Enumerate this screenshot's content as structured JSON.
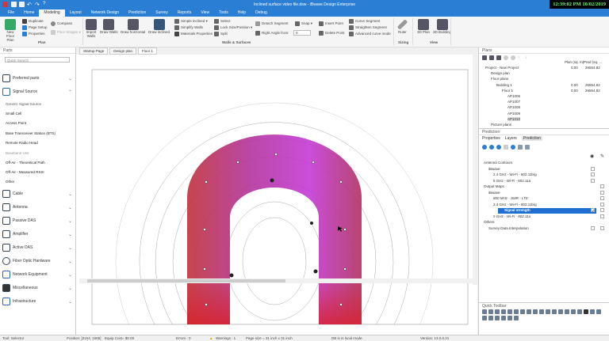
{
  "window": {
    "title": "Inclined surface video file.dsw - iBwave Design Enterprise",
    "clock": "12:39:02 PM 10/02/2019"
  },
  "tabs": [
    "File",
    "Home",
    "Modeling",
    "Layout",
    "Network Design",
    "Prediction",
    "Survey",
    "Reports",
    "View",
    "Tools",
    "Help",
    "Debug"
  ],
  "ribbon": {
    "plan": {
      "new_floor_plan": "New Floor Plan",
      "duplicate": "Duplicate",
      "page_setup": "Page Setup",
      "properties": "Properties",
      "compass": "Compass",
      "floor_images": "Floor Images",
      "group": "Plan"
    },
    "walls": {
      "import_walls": "Import Walls",
      "draw_walls": "Draw Walls",
      "draw_horizontal": "Draw horizontal",
      "draw_inclined": "Draw inclined",
      "simple_inclined": "Simple inclined",
      "simplify_walls": "Simplify Walls",
      "materials_properties": "Materials Properties",
      "select": "Select",
      "lock_size_position": "Lock Size/Position",
      "split": "Split",
      "detach_segment": "Detach Segment",
      "snap": "Snap",
      "right_angle_from": "Right Angle from:",
      "right_angle_value": "0",
      "insert_point": "Insert Point",
      "delete_point": "Delete Point",
      "curve_segment": "Curve Segment",
      "straighten_segment": "Straighten Segment",
      "advanced_curve_mode": "Advanced curve mode",
      "group": "Walls & Surfaces"
    },
    "sizing": {
      "ruler": "Ruler",
      "group": "Sizing"
    },
    "view": {
      "plan3d": "3D Plan",
      "building3d": "3D Building",
      "group": "View"
    }
  },
  "parts": {
    "title": "Parts",
    "search_placeholder": "Quick Search",
    "categories": [
      "Preferred parts",
      "Signal Source",
      "Cable",
      "Antenna",
      "Passive DAS",
      "Amplifier",
      "Active DAS",
      "Fiber Optic Hardware",
      "Network Equipment",
      "Miscellaneous",
      "Infrastructure"
    ],
    "signal_source_items": [
      "Generic Signal Source",
      "Small Cell",
      "Access Point",
      "Base Transceiver Station (BTS)",
      "Remote Radio Head",
      "Baseband Unit",
      "Off-Air - Theoretical Path",
      "Off-Air - Measured RSSI",
      "Other"
    ]
  },
  "doc_tabs": [
    "Startup Page",
    "Design plan",
    "Floor 1"
  ],
  "plans": {
    "title": "Plans",
    "columns": [
      "Plan (sq. m)",
      "Pred (sq. ..."
    ],
    "tree": [
      {
        "label": "Project - New Project",
        "plan": "0.00",
        "pred": "26554.82"
      },
      {
        "label": "Design plan",
        "plan": "",
        "pred": ""
      },
      {
        "label": "Floor plans",
        "plan": "",
        "pred": ""
      },
      {
        "label": "Building 1",
        "plan": "0.00",
        "pred": "26554.82"
      },
      {
        "label": "Floor 1",
        "plan": "0.00",
        "pred": "26554.82"
      },
      {
        "label": "AP1006",
        "plan": "",
        "pred": ""
      },
      {
        "label": "AP1007",
        "plan": "",
        "pred": ""
      },
      {
        "label": "AP1008",
        "plan": "",
        "pred": ""
      },
      {
        "label": "AP1009",
        "plan": "",
        "pred": ""
      },
      {
        "label": "AP1010",
        "plan": "",
        "pred": ""
      },
      {
        "label": "Picture plans",
        "plan": "",
        "pred": ""
      }
    ]
  },
  "prediction": {
    "title": "Prediction",
    "tabs": [
      "Properties",
      "Layers",
      "Prediction"
    ],
    "tree": [
      "Antenna Contours",
      "iBwave",
      "2.4 GHz - Wi-Fi - 802.11b/g",
      "5 GHz - Wi-Fi - 802.11a",
      "Output Maps",
      "iBwave",
      "800 MHz - SMR - LTE",
      "2.4 GHz - Wi-Fi - 802.11b/g",
      "Signal strength",
      "5 GHz - Wi-Fi - 802.11a",
      "Others",
      "Survey Data Interpolation"
    ]
  },
  "quick_toolbar": {
    "title": "Quick Toolbar"
  },
  "status": {
    "tool": "Tool: Selector",
    "position": "Position: [2154, 1065]",
    "equip_cost": "Equip Cost= $0.00",
    "errors": "Errors : 0",
    "warnings": "Warnings : 1",
    "page_size": "Page size = 31 inch x 31 inch",
    "db": "DB is in local mode.",
    "version": "Version: 13.0.0.21"
  }
}
